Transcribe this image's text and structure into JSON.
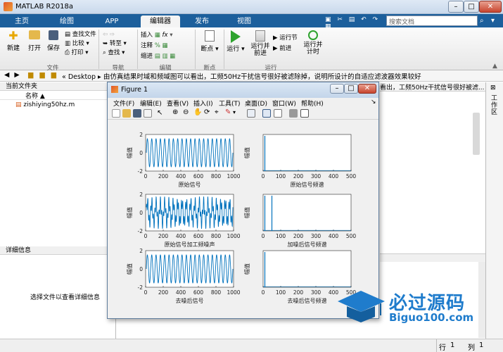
{
  "window": {
    "title": "MATLAB R2018a",
    "min": "–",
    "max": "□",
    "close": "✕"
  },
  "tabs": [
    "主页",
    "绘图",
    "APP",
    "编辑器",
    "发布",
    "视图"
  ],
  "active_tab": "编辑器",
  "search": {
    "placeholder": "搜索文档"
  },
  "ribbon": {
    "file": {
      "new": "新建",
      "open": "打开",
      "save": "保存",
      "find_files": "查找文件",
      "compare": "比较",
      "print": "打印",
      "section": "文件"
    },
    "nav": {
      "goto": "转至",
      "find": "查找",
      "section": "导航"
    },
    "edit": {
      "insert": "插入",
      "comment": "注释",
      "indent": "缩进",
      "fx": "fx",
      "section": "编辑"
    },
    "breakpoints": {
      "label": "断点",
      "section": "断点"
    },
    "run": {
      "run": "运行",
      "run_advance": "运行并\n前进",
      "run_section": "运行节",
      "advance": "前进",
      "run_time": "运行并\n计时",
      "section": "运行"
    }
  },
  "pathbar": {
    "root": "Desktop",
    "path": "由仿真结果时域和频域图可以看出，工频50Hz干扰信号很好被滤除掉，说明所设计的自适应滤波器效果较好",
    "overflow": "看出，工频50Hz干扰信号很好被滤..."
  },
  "left": {
    "current_folder": "当前文件夹",
    "col_name": "名称",
    "file": "zishiying50hz.m",
    "details": "详细信息",
    "details_hint": "选择文件以查看详细信息"
  },
  "figure": {
    "title": "Figure 1",
    "menu": [
      "文件(F)",
      "编辑(E)",
      "查看(V)",
      "插入(I)",
      "工具(T)",
      "桌面(D)",
      "窗口(W)",
      "帮助(H)"
    ],
    "ylabel": "幅值",
    "time_axes": {
      "xticks": [
        "0",
        "200",
        "400",
        "600",
        "800",
        "1000"
      ],
      "yticks": [
        "2",
        "0",
        "-2"
      ]
    },
    "freq_axes": {
      "xticks": [
        "0",
        "100",
        "200",
        "300",
        "400",
        "500"
      ]
    },
    "captions": {
      "a": "原始信号",
      "b": "原始信号频谱",
      "c": "原始信号加工频噪声",
      "d": "加噪后信号频谱",
      "e": "去噪后信号",
      "f": "去噪后信号频谱"
    }
  },
  "status": {
    "row_label": "行",
    "row": "1",
    "col_label": "列",
    "col": "1"
  },
  "watermark": {
    "cn": "必过源码",
    "url": "Biguo100.com"
  },
  "colors": {
    "accent": "#1c5f9c",
    "plot": "#0072bd"
  }
}
